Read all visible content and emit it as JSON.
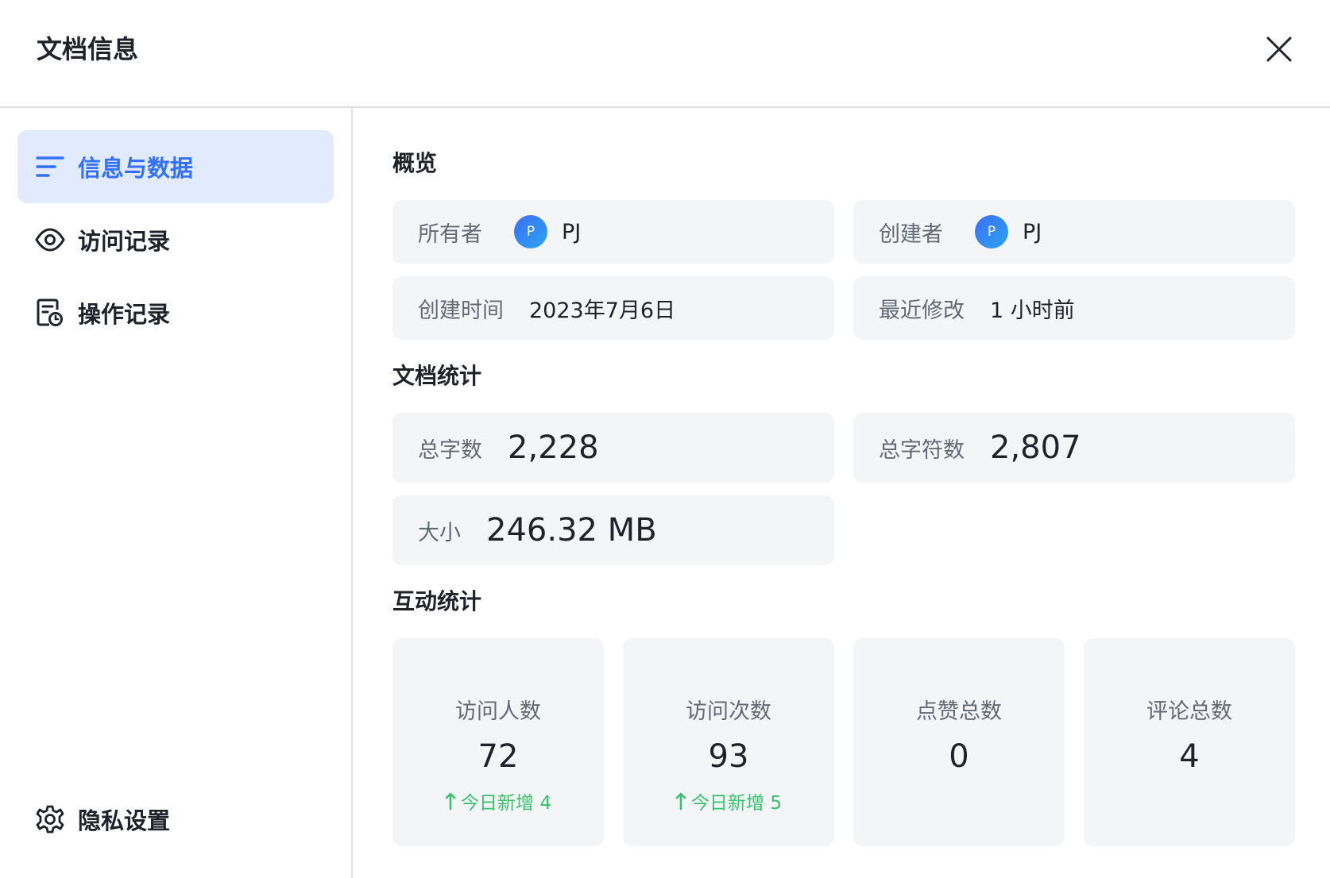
{
  "dialog": {
    "title": "文档信息"
  },
  "sidebar": {
    "items": [
      {
        "label": "信息与数据",
        "icon": "list-icon",
        "active": true
      },
      {
        "label": "访问记录",
        "icon": "eye-icon"
      },
      {
        "label": "操作记录",
        "icon": "document-clock-icon"
      }
    ],
    "footer": {
      "label": "隐私设置",
      "icon": "gear-icon"
    }
  },
  "overview": {
    "title": "概览",
    "owner": {
      "label": "所有者",
      "avatar": "P",
      "name": "PJ"
    },
    "creator": {
      "label": "创建者",
      "avatar": "P",
      "name": "PJ"
    },
    "created": {
      "label": "创建时间",
      "value": "2023年7月6日"
    },
    "modified": {
      "label": "最近修改",
      "value": "1 小时前"
    }
  },
  "doc_stats": {
    "title": "文档统计",
    "words": {
      "label": "总字数",
      "value": "2,228"
    },
    "chars": {
      "label": "总字符数",
      "value": "2,807"
    },
    "size": {
      "label": "大小",
      "value": "246.32 MB"
    }
  },
  "interaction": {
    "title": "互动统计",
    "stats": [
      {
        "label": "访问人数",
        "value": "72",
        "delta": "今日新增 4"
      },
      {
        "label": "访问次数",
        "value": "93",
        "delta": "今日新增 5"
      },
      {
        "label": "点赞总数",
        "value": "0",
        "delta": ""
      },
      {
        "label": "评论总数",
        "value": "4",
        "delta": ""
      }
    ]
  },
  "colors": {
    "accent": "#3370ff",
    "positive": "#34c26b",
    "card_bg": "#f4f5f7",
    "active_bg": "#e1eaff"
  }
}
